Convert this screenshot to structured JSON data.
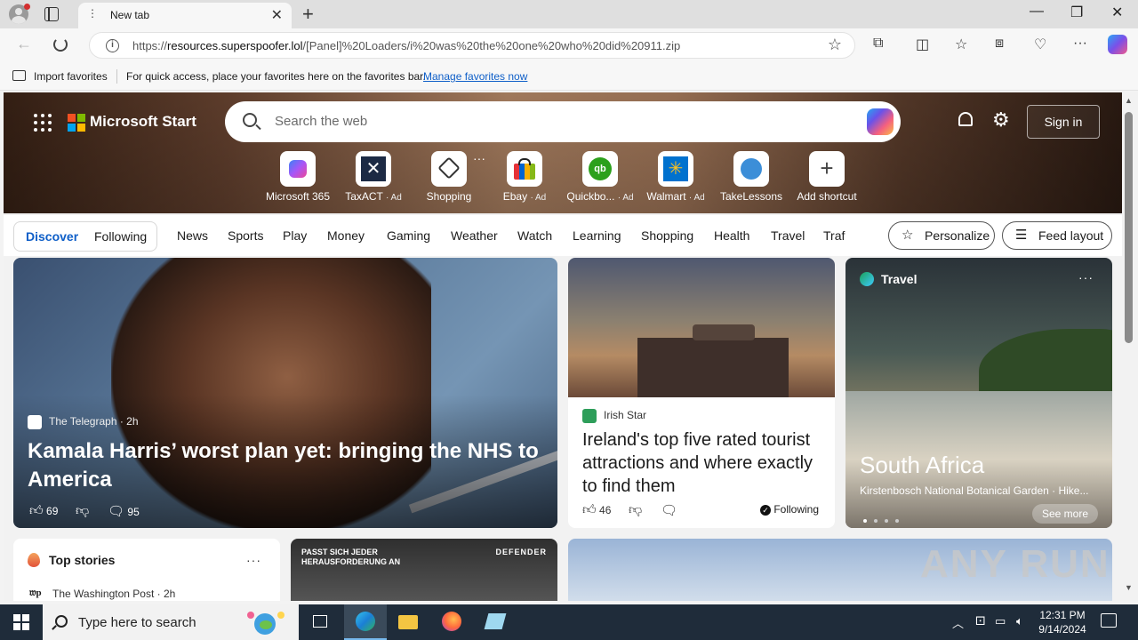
{
  "browser": {
    "tab_title": "New tab",
    "url_host": "resources.superspoofer.lol",
    "url_prefix": "https://",
    "url_path": "/[Panel]%20Loaders/i%20was%20the%20one%20who%20did%20911.zip",
    "favorites": {
      "import_label": "Import favorites",
      "message": "For quick access, place your favorites here on the favorites bar.",
      "manage_link": "Manage favorites now"
    }
  },
  "header": {
    "brand": "Microsoft Start",
    "search_placeholder": "Search the web",
    "signin_label": "Sign in"
  },
  "shortcuts": [
    {
      "label": "Microsoft 365",
      "ad": "",
      "icon": "microsoft365-icon"
    },
    {
      "label": "TaxACT",
      "ad": "· Ad",
      "icon": "taxact-icon"
    },
    {
      "label": "Shopping",
      "ad": "",
      "icon": "shopping-tag-icon"
    },
    {
      "label": "Ebay",
      "ad": "· Ad",
      "icon": "ebay-icon"
    },
    {
      "label": "Quickbo...",
      "ad": "· Ad",
      "icon": "quickbooks-icon"
    },
    {
      "label": "Walmart",
      "ad": "· Ad",
      "icon": "walmart-icon"
    },
    {
      "label": "TakeLessons",
      "ad": "",
      "icon": "takelessons-icon"
    },
    {
      "label": "Add shortcut",
      "ad": "",
      "icon": "plus-icon"
    }
  ],
  "feed_nav": {
    "discover": "Discover",
    "following": "Following",
    "categories": [
      "News",
      "Sports",
      "Play",
      "Money",
      "Gaming",
      "Weather",
      "Watch",
      "Learning",
      "Shopping",
      "Health",
      "Travel",
      "Traf"
    ],
    "personalize": "Personalize",
    "feed_layout": "Feed layout"
  },
  "cards": {
    "hero": {
      "source": "The Telegraph · 2h",
      "title": "Kamala Harris’ worst plan yet: bringing the NHS to America",
      "likes": "69",
      "comments": "95"
    },
    "ireland": {
      "source": "Irish Star",
      "title": "Ireland's top five rated tourist attractions and where exactly to find them",
      "likes": "46",
      "following": "Following"
    },
    "travel": {
      "category": "Travel",
      "title": "South Africa",
      "subtitle": "Kirstenbosch National Botanical Garden · Hike...",
      "see_more": "See more"
    },
    "top_stories": {
      "title": "Top stories",
      "source": "The Washington Post · 2h"
    },
    "ad": {
      "text_line1": "PASST SICH JEDER",
      "text_line2": "HERAUSFORDERUNG AN",
      "brand": "DEFENDER"
    }
  },
  "watermark": "ANY RUN",
  "taskbar": {
    "search_placeholder": "Type here to search",
    "time": "12:31 PM",
    "date": "9/14/2024"
  },
  "colors": {
    "accent": "#0f5fc8",
    "taskbar": "#1f2c3a"
  }
}
